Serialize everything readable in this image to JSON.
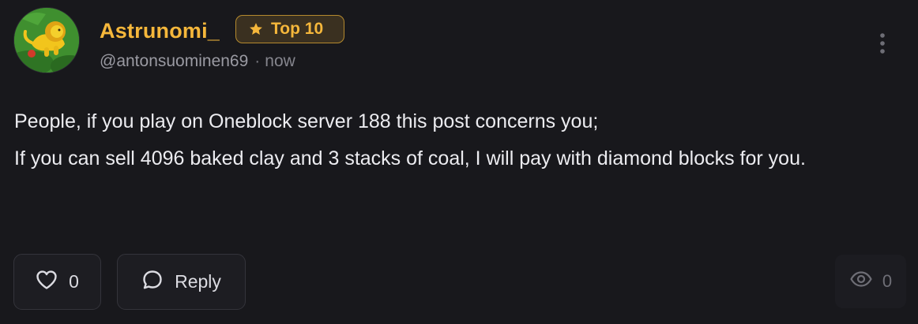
{
  "author": {
    "display_name": "Astrunomi_",
    "handle": "@antonsuominen69",
    "separator": "·",
    "time": "now",
    "avatar_icon": "lion-avatar-icon"
  },
  "badge": {
    "label": "Top 10",
    "icon": "star-icon",
    "color": "#f5b73b"
  },
  "post": {
    "lines": [
      "People, if you play on Oneblock server 188 this post concerns you;",
      "If you can sell 4096 baked clay and 3 stacks of coal, I will pay with diamond blocks for you."
    ]
  },
  "actions": {
    "like_count": "0",
    "like_icon": "heart-icon",
    "reply_label": "Reply",
    "reply_icon": "speech-bubble-icon",
    "more_icon": "vertical-dots-icon"
  },
  "stats": {
    "views": "0",
    "views_icon": "eye-icon"
  },
  "colors": {
    "background": "#18181c",
    "accent": "#f5b73b",
    "text": "#ececf0",
    "muted": "#9a9aa2"
  }
}
